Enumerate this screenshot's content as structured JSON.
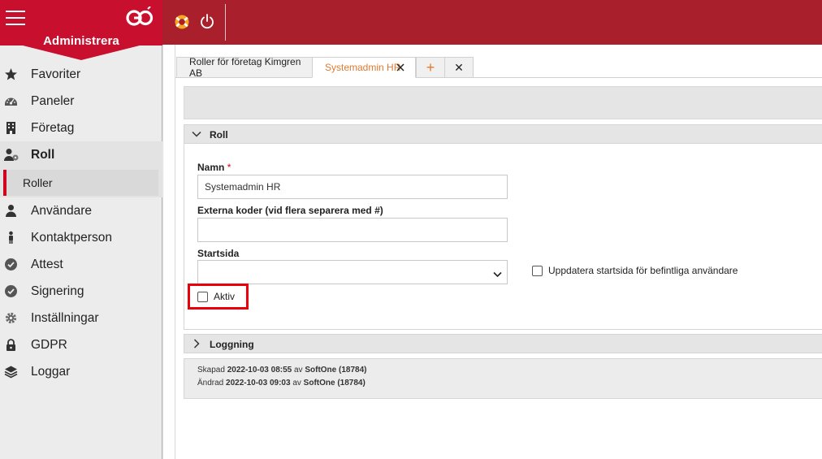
{
  "app": {
    "brand_title": "Administrera",
    "accent_color": "#c8102e",
    "topbar_color": "#a91f2c",
    "logo_text": "GO"
  },
  "topbar": {
    "icons": [
      "lifebuoy-icon",
      "power-icon"
    ]
  },
  "sidebar": {
    "items": [
      {
        "label": "Favoriter",
        "icon": "star-icon"
      },
      {
        "label": "Paneler",
        "icon": "dashboard-icon"
      },
      {
        "label": "Företag",
        "icon": "building-icon"
      },
      {
        "label": "Roll",
        "icon": "user-role-icon"
      },
      {
        "label": "Användare",
        "icon": "user-icon"
      },
      {
        "label": "Kontaktperson",
        "icon": "contact-person-icon"
      },
      {
        "label": "Attest",
        "icon": "check-circle-icon"
      },
      {
        "label": "Signering",
        "icon": "check-circle-icon"
      },
      {
        "label": "Inställningar",
        "icon": "gear-icon"
      },
      {
        "label": "GDPR",
        "icon": "lock-icon"
      },
      {
        "label": "Loggar",
        "icon": "layers-icon"
      }
    ],
    "active_item": "Roll",
    "sub_items": [
      {
        "label": "Roller"
      }
    ]
  },
  "tabs": [
    {
      "label": "Roller för företag Kimgren AB"
    },
    {
      "label": "Systemadmin HR",
      "active": true
    },
    {
      "label": "+"
    },
    {
      "label": "✕"
    }
  ],
  "roll_section": {
    "title": "Roll",
    "name_label": "Namn",
    "required_mark": "*",
    "name_value": "Systemadmin HR",
    "external_codes_label": "Externa koder (vid flera separera med #)",
    "external_codes_value": "",
    "startpage_label": "Startsida",
    "startpage_value": "",
    "update_startpage_label": "Uppdatera startsida för befintliga användare",
    "update_startpage_checked": false,
    "active_label": "Aktiv",
    "active_checked": false
  },
  "log_section": {
    "title": "Loggning"
  },
  "meta": {
    "created_prefix": "Skapad",
    "created_value": "2022-10-03 08:55",
    "created_by_prefix": "av",
    "created_by": "SoftOne (18784)",
    "changed_prefix": "Ändrad",
    "changed_value": "2022-10-03 09:03",
    "changed_by_prefix": "av",
    "changed_by": "SoftOne (18784)"
  }
}
